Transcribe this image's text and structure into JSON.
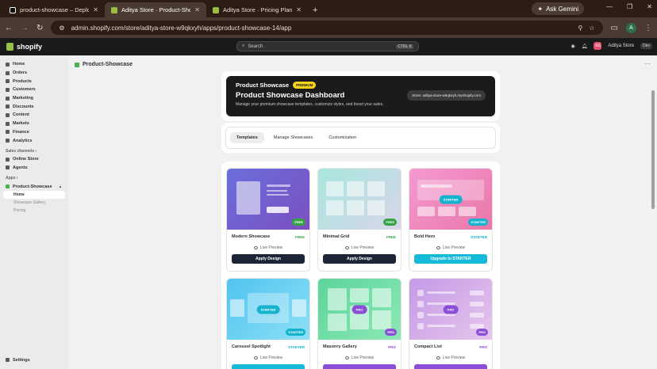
{
  "browser": {
    "tabs": [
      {
        "title": "product-showcase – Deployme",
        "color": "#ffffff"
      },
      {
        "title": "Aditya Store · Product-Showcas",
        "color": "#95bf47"
      },
      {
        "title": "Aditya Store · Pricing Plans · Sh",
        "color": "#95bf47"
      }
    ],
    "gemini_label": "Ask Gemini",
    "url": "admin.shopify.com/store/aditya-store-w9qkxyh/apps/product-showcase-14/app",
    "profile_initial": "A"
  },
  "shopify": {
    "logo": "shopify",
    "search_placeholder": "Search",
    "search_kbd": "CTRL K",
    "store_initials": "AS",
    "store_name": "Aditya Store",
    "store_tag": "Dev"
  },
  "sidebar": {
    "items": [
      "Home",
      "Orders",
      "Products",
      "Customers",
      "Marketing",
      "Discounts",
      "Content",
      "Markets",
      "Finance",
      "Analytics"
    ],
    "sales_channels_label": "Sales channels",
    "sales_channels": [
      "Online Store",
      "Agents"
    ],
    "apps_label": "Apps",
    "app_name": "Product-Showcase",
    "app_subs": [
      "Home",
      "Showcase Gallery",
      "Pricing"
    ],
    "settings": "Settings"
  },
  "page": {
    "title": "Product-Showcase",
    "hero_small": "Product Showcase",
    "hero_badge": "PREMIUM",
    "hero_title": "Product Showcase Dashboard",
    "hero_desc": "Manage your premium showcase templates, customize styles, and boost your sales.",
    "store_chip": "Store: aditya-store-w9qkxyh.myshopify.com",
    "tabs": [
      "Templates",
      "Manage Showcases",
      "Customization"
    ]
  },
  "templates": [
    {
      "name": "Modern Showcase",
      "level": "FREE",
      "level_color": "#36a344",
      "button": "Apply Design",
      "button_color": "#1c2536",
      "thumb": "linear-gradient(135deg,#6a6fdc,#7b4fc1)",
      "center": "",
      "preview": "Live Preview"
    },
    {
      "name": "Minimal Grid",
      "level": "FREE",
      "level_color": "#36a344",
      "button": "Apply Design",
      "button_color": "#1c2536",
      "thumb": "linear-gradient(135deg,#a8e6df,#d8d6e8)",
      "center": "",
      "preview": "Live Preview"
    },
    {
      "name": "Bold Hero",
      "level": "STARTER",
      "level_color": "#16b3cf",
      "button": "Upgrade to STARTER",
      "button_color": "#17b9d8",
      "thumb": "linear-gradient(135deg,#f49ad2,#e977a8)",
      "center": "STARTER",
      "preview": "Live Preview"
    },
    {
      "name": "Carousel Spotlight",
      "level": "STARTER",
      "level_color": "#16b3cf",
      "button": "",
      "button_color": "#17b9d8",
      "thumb": "linear-gradient(135deg,#4fc4f0,#8fe0f5)",
      "center": "STARTER",
      "preview": "Live Preview"
    },
    {
      "name": "Masonry Gallery",
      "level": "PRO",
      "level_color": "#8a4fd6",
      "button": "",
      "button_color": "#8a4fd6",
      "thumb": "linear-gradient(135deg,#5bd59a,#8ee8b6)",
      "center": "PRO",
      "preview": "Live Preview"
    },
    {
      "name": "Compact List",
      "level": "PRO",
      "level_color": "#8a4fd6",
      "button": "",
      "button_color": "#8a4fd6",
      "thumb": "linear-gradient(135deg,#c49ae6,#e6c6ec)",
      "center": "PRO",
      "preview": "Live Preview"
    }
  ],
  "tier_badges": [
    "FREE",
    "FREE",
    "STARTER",
    "STARTER",
    "PRO",
    "PRO"
  ]
}
